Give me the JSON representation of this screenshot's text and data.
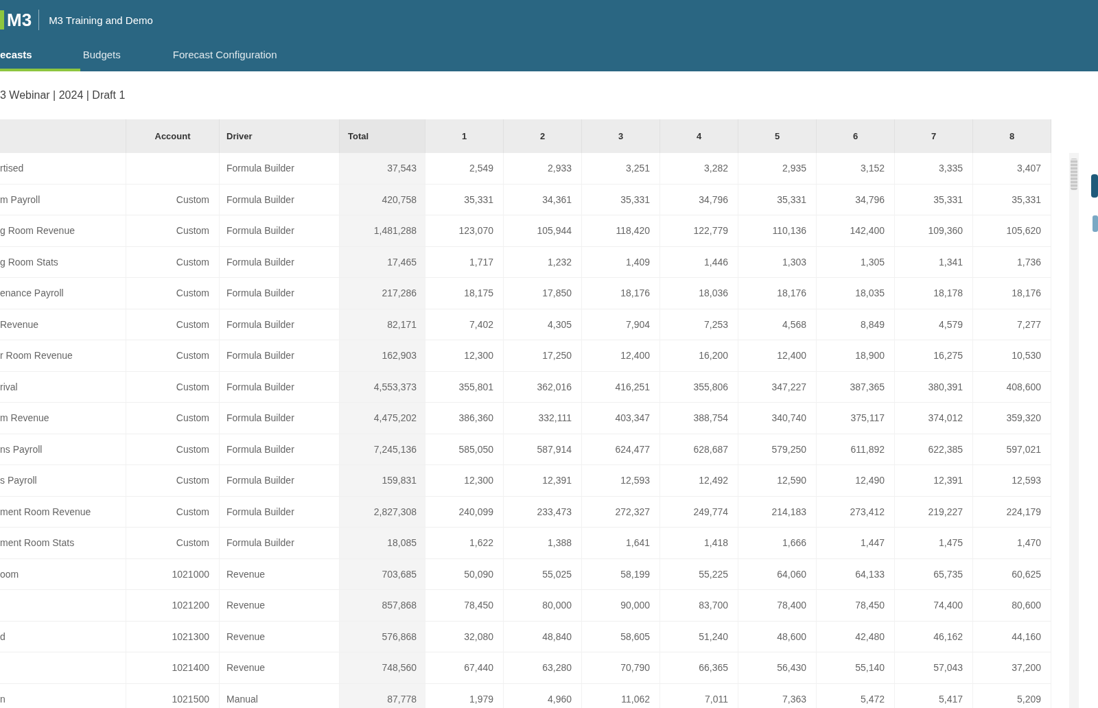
{
  "app_bar": {
    "logo": "M3",
    "title": "M3 Training and Demo"
  },
  "tabs": [
    {
      "label": "ecasts",
      "selected": true
    },
    {
      "label": "Budgets",
      "selected": false
    },
    {
      "label": "Forecast Configuration",
      "selected": false
    }
  ],
  "breadcrumb": "3 Webinar | 2024 | Draft 1",
  "table": {
    "columns": [
      "Account",
      "Driver",
      "Total",
      "1",
      "2",
      "3",
      "4",
      "5",
      "6",
      "7",
      "8"
    ],
    "rows": [
      {
        "name": "rtised",
        "driver": "Formula Builder",
        "total": "37,543",
        "values": [
          "2,549",
          "2,933",
          "3,251",
          "3,282",
          "2,935",
          "3,152",
          "3,335",
          "3,407"
        ]
      },
      {
        "name": "m Payroll",
        "account": "Custom",
        "driver": "Formula Builder",
        "total": "420,758",
        "values": [
          "35,331",
          "34,361",
          "35,331",
          "34,796",
          "35,331",
          "34,796",
          "35,331",
          "35,331"
        ]
      },
      {
        "name": "g Room Revenue",
        "account": "Custom",
        "driver": "Formula Builder",
        "total": "1,481,288",
        "values": [
          "123,070",
          "105,944",
          "118,420",
          "122,779",
          "110,136",
          "142,400",
          "109,360",
          "105,620"
        ]
      },
      {
        "name": "g Room Stats",
        "account": "Custom",
        "driver": "Formula Builder",
        "total": "17,465",
        "values": [
          "1,717",
          "1,232",
          "1,409",
          "1,446",
          "1,303",
          "1,305",
          "1,341",
          "1,736"
        ]
      },
      {
        "name": "enance Payroll",
        "account": "Custom",
        "driver": "Formula Builder",
        "total": "217,286",
        "values": [
          "18,175",
          "17,850",
          "18,176",
          "18,036",
          "18,176",
          "18,035",
          "18,178",
          "18,176"
        ]
      },
      {
        "name": "Revenue",
        "account": "Custom",
        "driver": "Formula Builder",
        "total": "82,171",
        "values": [
          "7,402",
          "4,305",
          "7,904",
          "7,253",
          "4,568",
          "8,849",
          "4,579",
          "7,277"
        ]
      },
      {
        "name": "r Room Revenue",
        "account": "Custom",
        "driver": "Formula Builder",
        "total": "162,903",
        "values": [
          "12,300",
          "17,250",
          "12,400",
          "16,200",
          "12,400",
          "18,900",
          "16,275",
          "10,530"
        ]
      },
      {
        "name": "rival",
        "account": "Custom",
        "driver": "Formula Builder",
        "total": "4,553,373",
        "values": [
          "355,801",
          "362,016",
          "416,251",
          "355,806",
          "347,227",
          "387,365",
          "380,391",
          "408,600"
        ]
      },
      {
        "name": "m Revenue",
        "account": "Custom",
        "driver": "Formula Builder",
        "total": "4,475,202",
        "values": [
          "386,360",
          "332,111",
          "403,347",
          "388,754",
          "340,740",
          "375,117",
          "374,012",
          "359,320"
        ]
      },
      {
        "name": "ns Payroll",
        "account": "Custom",
        "driver": "Formula Builder",
        "total": "7,245,136",
        "values": [
          "585,050",
          "587,914",
          "624,477",
          "628,687",
          "579,250",
          "611,892",
          "622,385",
          "597,021"
        ]
      },
      {
        "name": "s Payroll",
        "account": "Custom",
        "driver": "Formula Builder",
        "total": "159,831",
        "values": [
          "12,300",
          "12,391",
          "12,593",
          "12,492",
          "12,590",
          "12,490",
          "12,391",
          "12,593"
        ]
      },
      {
        "name": "ment Room Revenue",
        "account": "Custom",
        "driver": "Formula Builder",
        "total": "2,827,308",
        "values": [
          "240,099",
          "233,473",
          "272,327",
          "249,774",
          "214,183",
          "273,412",
          "219,227",
          "224,179"
        ]
      },
      {
        "name": "ment Room Stats",
        "account": "Custom",
        "driver": "Formula Builder",
        "total": "18,085",
        "values": [
          "1,622",
          "1,388",
          "1,641",
          "1,418",
          "1,666",
          "1,447",
          "1,475",
          "1,470"
        ]
      },
      {
        "name": "oom",
        "account": "1021000",
        "driver": "Revenue",
        "total": "703,685",
        "values": [
          "50,090",
          "55,025",
          "58,199",
          "55,225",
          "64,060",
          "64,133",
          "65,735",
          "60,625"
        ]
      },
      {
        "account": "1021200",
        "driver": "Revenue",
        "total": "857,868",
        "values": [
          "78,450",
          "80,000",
          "90,000",
          "83,700",
          "78,400",
          "78,450",
          "74,400",
          "80,600"
        ]
      },
      {
        "name": "d",
        "account": "1021300",
        "driver": "Revenue",
        "total": "576,868",
        "values": [
          "32,080",
          "48,840",
          "58,605",
          "51,240",
          "48,600",
          "42,480",
          "46,162",
          "44,160"
        ]
      },
      {
        "account": "1021400",
        "driver": "Revenue",
        "total": "748,560",
        "values": [
          "67,440",
          "63,280",
          "70,790",
          "66,365",
          "56,430",
          "55,140",
          "57,043",
          "37,200"
        ]
      },
      {
        "name": "n",
        "account": "1021500",
        "driver": "Manual",
        "total": "87,778",
        "values": [
          "1,979",
          "4,960",
          "11,062",
          "7,011",
          "7,363",
          "5,472",
          "5,417",
          "5,209"
        ]
      }
    ]
  }
}
